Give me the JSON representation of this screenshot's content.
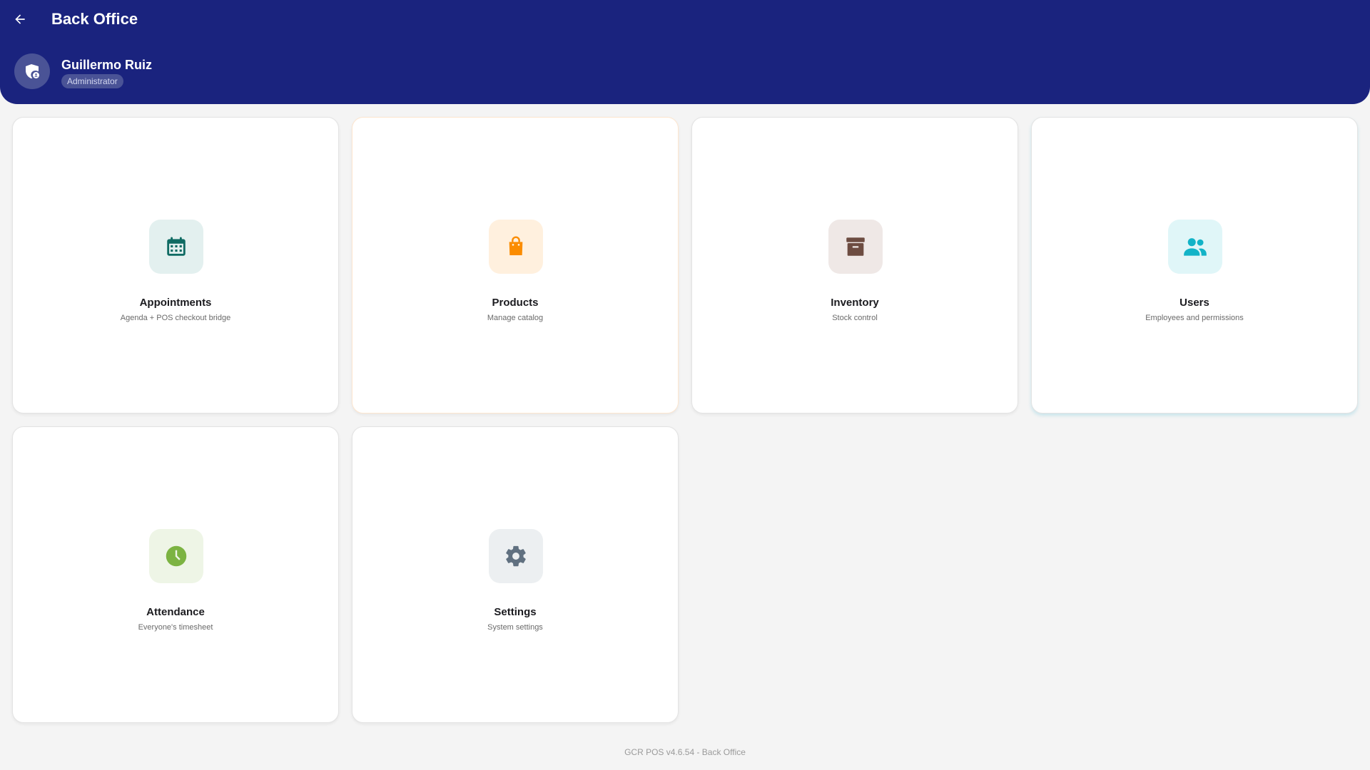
{
  "header": {
    "title": "Back Office",
    "back_icon": "arrow-left-icon",
    "background": "#1a237e"
  },
  "user": {
    "name": "Guillermo Ruiz",
    "role": "Administrator",
    "avatar_icon": "admin-shield-icon"
  },
  "cards": [
    {
      "title": "Appointments",
      "subtitle": "Agenda + POS checkout bridge",
      "icon": "calendar-icon",
      "icon_color": "#0f6b63",
      "icon_bg": "#e3f0ef"
    },
    {
      "title": "Products",
      "subtitle": "Manage catalog",
      "icon": "shopping-bag-icon",
      "icon_color": "#fb8c00",
      "icon_bg": "#fff0de"
    },
    {
      "title": "Inventory",
      "subtitle": "Stock control",
      "icon": "archive-box-icon",
      "icon_color": "#6d4c41",
      "icon_bg": "#efe8e6"
    },
    {
      "title": "Users",
      "subtitle": "Employees and permissions",
      "icon": "people-icon",
      "icon_color": "#12b3c7",
      "icon_bg": "#e0f6f8"
    },
    {
      "title": "Attendance",
      "subtitle": "Everyone's timesheet",
      "icon": "clock-icon",
      "icon_color": "#7cb342",
      "icon_bg": "#eef5e6"
    },
    {
      "title": "Settings",
      "subtitle": "System settings",
      "icon": "gear-icon",
      "icon_color": "#607080",
      "icon_bg": "#eceff1"
    }
  ],
  "footer": {
    "version_text": "GCR POS v4.6.54 - Back Office"
  }
}
